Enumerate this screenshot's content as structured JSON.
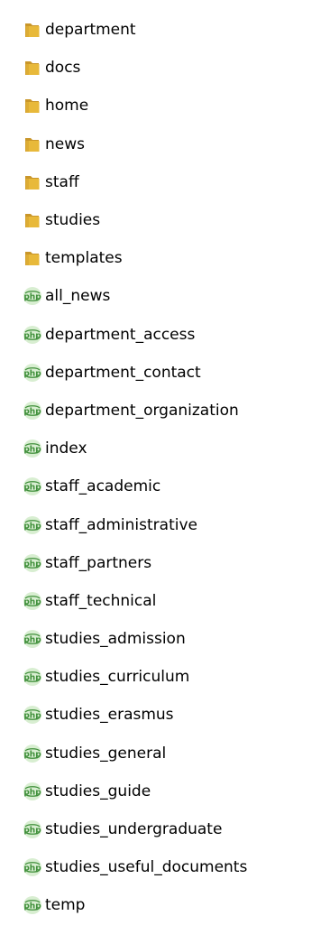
{
  "items": [
    {
      "name": "department",
      "type": "folder"
    },
    {
      "name": "docs",
      "type": "folder"
    },
    {
      "name": "home",
      "type": "folder"
    },
    {
      "name": "news",
      "type": "folder"
    },
    {
      "name": "staff",
      "type": "folder"
    },
    {
      "name": "studies",
      "type": "folder"
    },
    {
      "name": "templates",
      "type": "folder"
    },
    {
      "name": "all_news",
      "type": "php"
    },
    {
      "name": "department_access",
      "type": "php"
    },
    {
      "name": "department_contact",
      "type": "php"
    },
    {
      "name": "department_organization",
      "type": "php"
    },
    {
      "name": "index",
      "type": "php"
    },
    {
      "name": "staff_academic",
      "type": "php"
    },
    {
      "name": "staff_administrative",
      "type": "php"
    },
    {
      "name": "staff_partners",
      "type": "php"
    },
    {
      "name": "staff_technical",
      "type": "php"
    },
    {
      "name": "studies_admission",
      "type": "php"
    },
    {
      "name": "studies_curriculum",
      "type": "php"
    },
    {
      "name": "studies_erasmus",
      "type": "php"
    },
    {
      "name": "studies_general",
      "type": "php"
    },
    {
      "name": "studies_guide",
      "type": "php"
    },
    {
      "name": "studies_undergraduate",
      "type": "php"
    },
    {
      "name": "studies_useful_documents",
      "type": "php"
    },
    {
      "name": "temp",
      "type": "php"
    }
  ],
  "icons": {
    "folder": "folder-icon",
    "php": "php-file-icon"
  },
  "colors": {
    "folder_main": "#e8b93a",
    "folder_dark": "#c9962a",
    "php_green": "#3f8f3a",
    "php_light": "#8fcf7a"
  }
}
